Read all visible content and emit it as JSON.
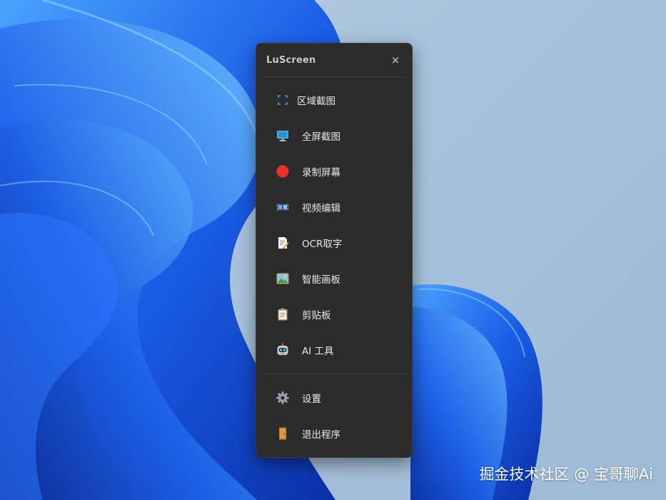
{
  "window": {
    "title": "LuScreen",
    "close_glyph": "×"
  },
  "menu": {
    "items": [
      {
        "label": "区域截图",
        "icon": "region-capture-icon"
      },
      {
        "label": "全屏截图",
        "icon": "monitor-icon"
      },
      {
        "label": "录制屏幕",
        "icon": "record-dot-icon"
      },
      {
        "label": "视频编辑",
        "icon": "film-strip-icon"
      },
      {
        "label": "OCR取字",
        "icon": "memo-pencil-icon"
      },
      {
        "label": "智能画板",
        "icon": "picture-icon"
      },
      {
        "label": "剪贴板",
        "icon": "clipboard-icon"
      },
      {
        "label": "AI 工具",
        "icon": "robot-icon"
      }
    ],
    "bottom_items": [
      {
        "label": "设置",
        "icon": "gear-icon"
      },
      {
        "label": "退出程序",
        "icon": "door-icon"
      }
    ]
  },
  "watermark": "掘金技术社区 @ 宝哥聊Ai",
  "colors": {
    "panel_bg": "#2b2b2b",
    "record_red": "#e8312f",
    "accent_blue": "#3aa0f0",
    "wallpaper_blue": "#1f5fe0"
  }
}
